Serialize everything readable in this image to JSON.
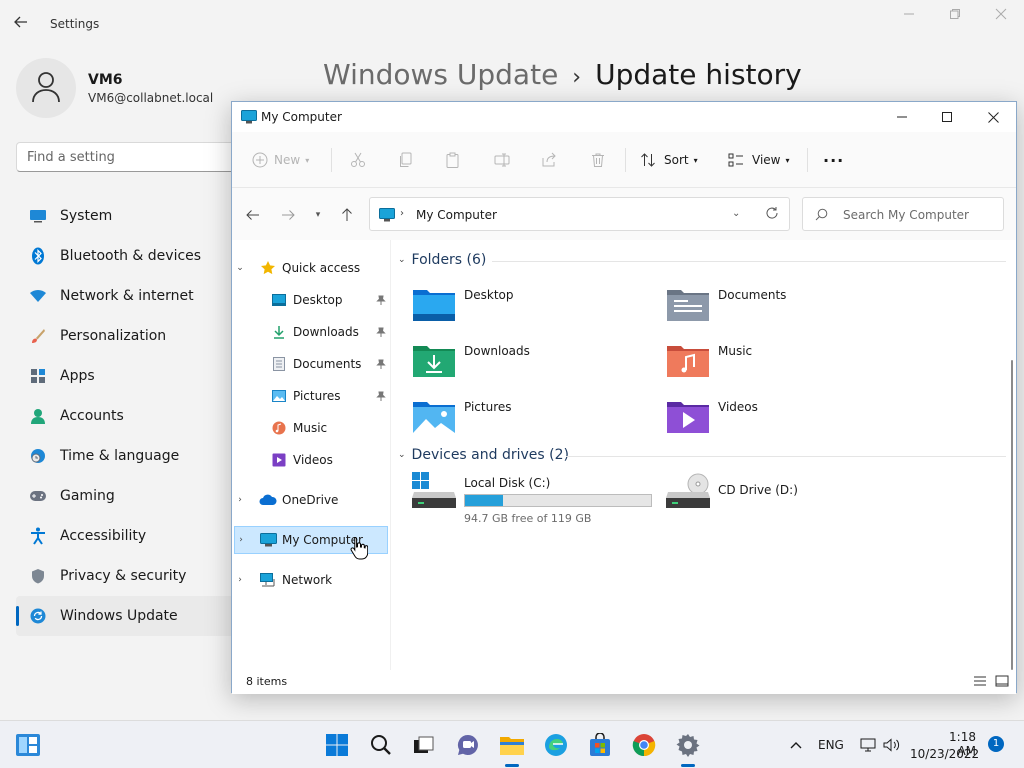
{
  "settings": {
    "window_title": "Settings",
    "user": {
      "name": "VM6",
      "email": "VM6@collabnet.local"
    },
    "search_placeholder": "Find a setting",
    "nav_items": [
      {
        "label": "System",
        "icon": "monitor-icon"
      },
      {
        "label": "Bluetooth & devices",
        "icon": "bluetooth-icon"
      },
      {
        "label": "Network & internet",
        "icon": "wifi-icon"
      },
      {
        "label": "Personalization",
        "icon": "brush-icon"
      },
      {
        "label": "Apps",
        "icon": "apps-icon"
      },
      {
        "label": "Accounts",
        "icon": "person-icon"
      },
      {
        "label": "Time & language",
        "icon": "clock-globe-icon"
      },
      {
        "label": "Gaming",
        "icon": "gamepad-icon"
      },
      {
        "label": "Accessibility",
        "icon": "accessibility-icon"
      },
      {
        "label": "Privacy & security",
        "icon": "shield-icon"
      },
      {
        "label": "Windows Update",
        "icon": "update-icon",
        "active": true
      }
    ],
    "breadcrumb": {
      "parent": "Windows Update",
      "current": "Update history"
    }
  },
  "explorer": {
    "title": "My Computer",
    "toolbar": {
      "new_label": "New",
      "sort_label": "Sort",
      "view_label": "View",
      "more_label": "···"
    },
    "address": {
      "path": "My Computer"
    },
    "search_placeholder": "Search My Computer",
    "navpane": {
      "quick_access": "Quick access",
      "pinned": [
        "Desktop",
        "Downloads",
        "Documents",
        "Pictures"
      ],
      "unpinned": [
        "Music",
        "Videos"
      ],
      "onedrive": "OneDrive",
      "my_computer": "My Computer",
      "network": "Network"
    },
    "folders_header": "Folders (6)",
    "folders": [
      "Desktop",
      "Documents",
      "Downloads",
      "Music",
      "Pictures",
      "Videos"
    ],
    "drives_header": "Devices and drives (2)",
    "drives": [
      {
        "name": "Local Disk (C:)",
        "free": "94.7 GB free of 119 GB",
        "used_fraction": 0.204
      },
      {
        "name": "CD Drive (D:)"
      }
    ],
    "status": "8 items"
  },
  "taskbar": {
    "language": "ENG",
    "time": "1:18 AM",
    "date": "10/23/2022",
    "notification_count": "1"
  },
  "colors": {
    "accent": "#0067c0",
    "selection": "#cce8ff",
    "drive_fill": "#26a0da"
  }
}
